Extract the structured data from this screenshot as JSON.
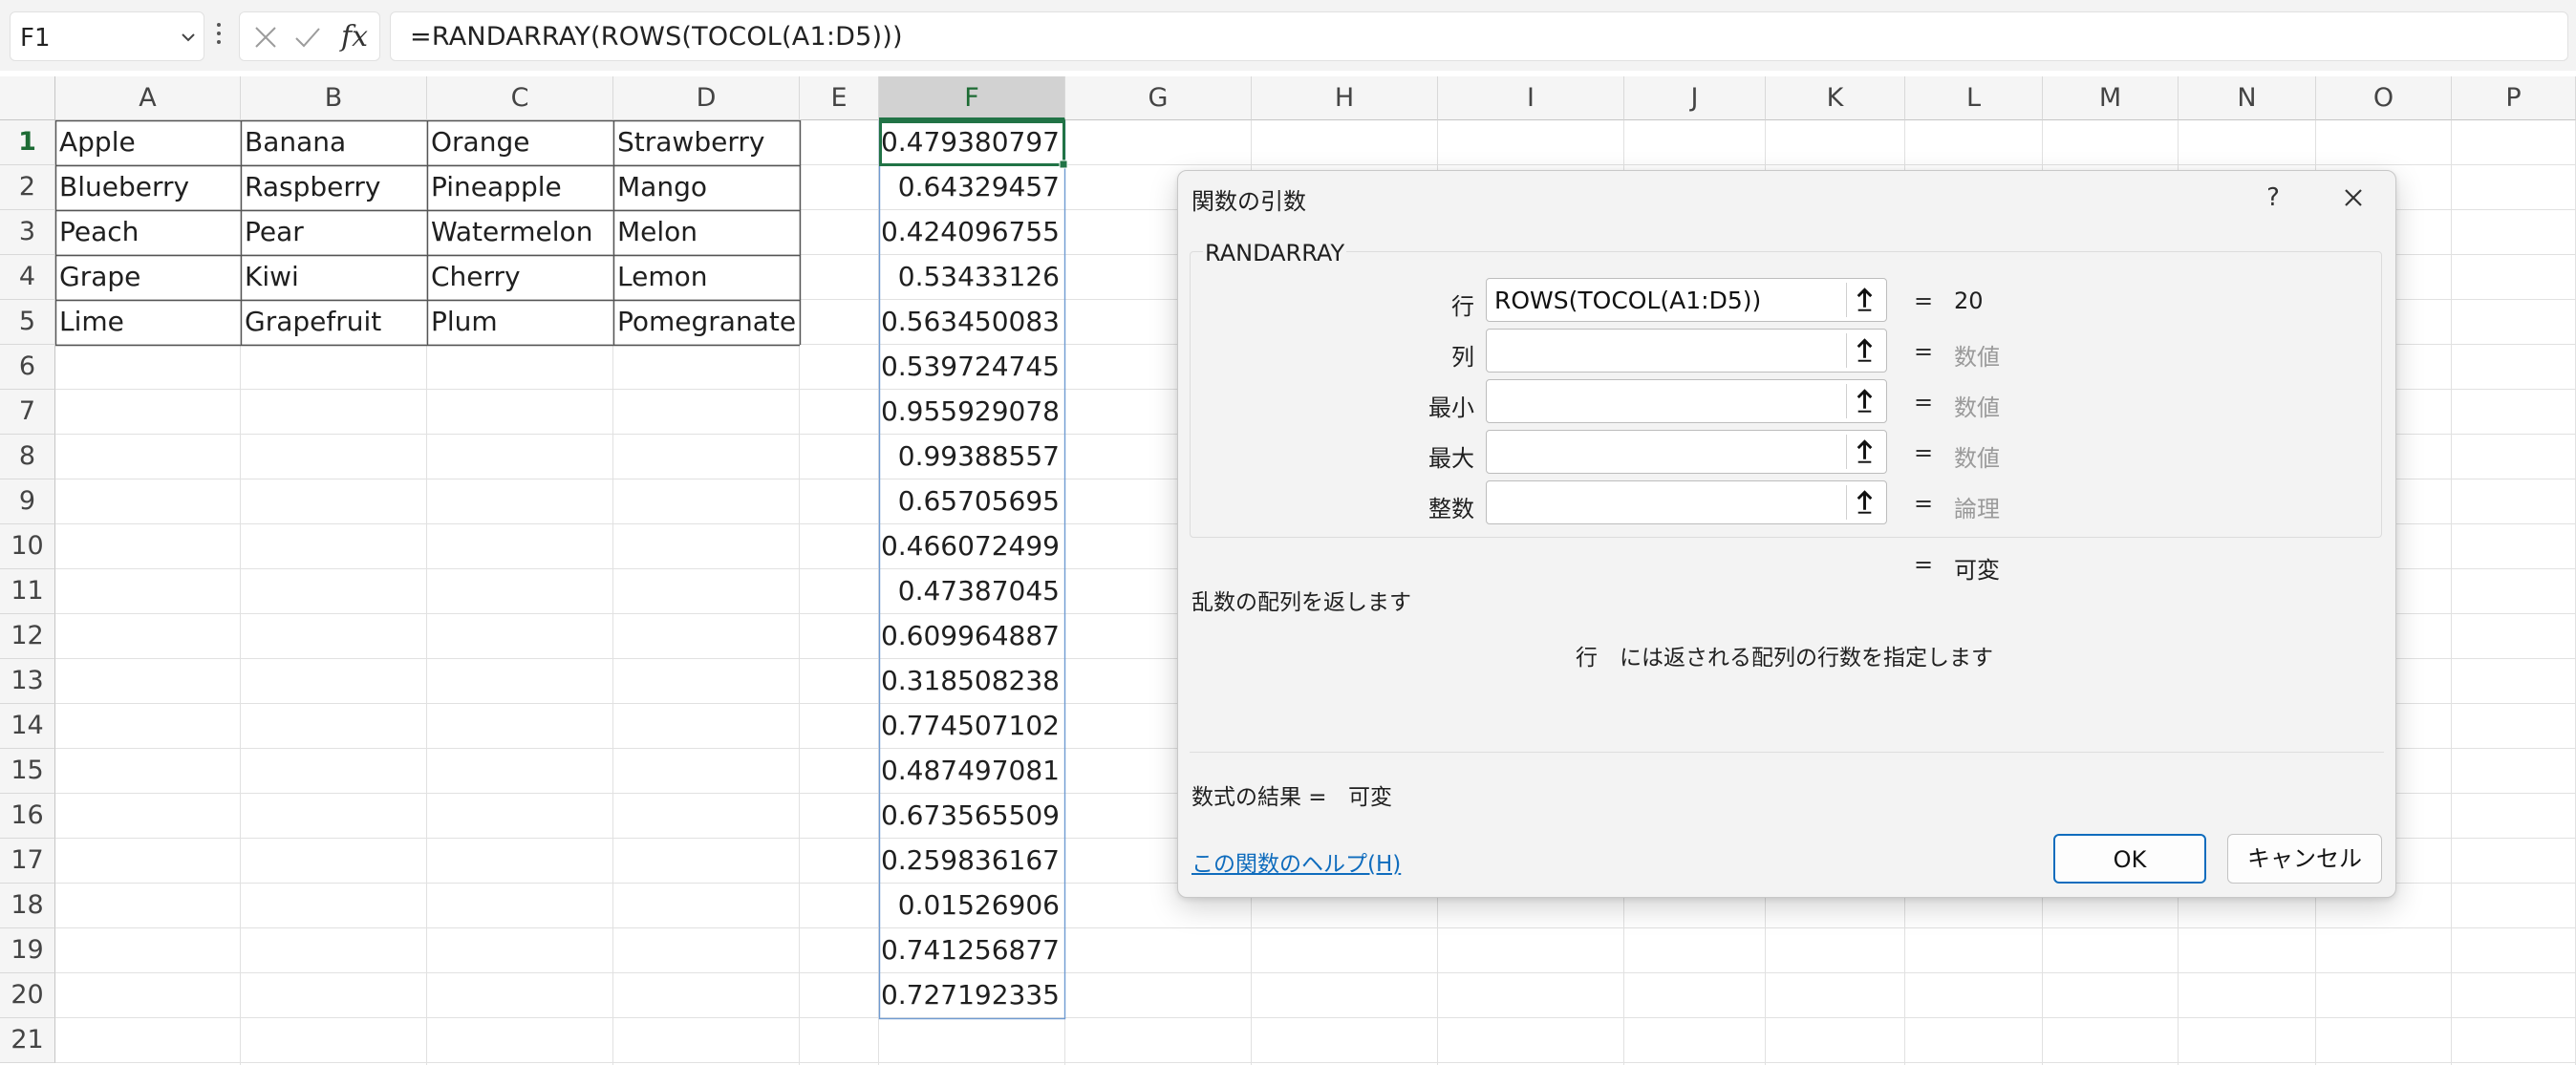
{
  "formula_bar": {
    "name_box": "F1",
    "formula": "=RANDARRAY(ROWS(TOCOL(A1:D5)))"
  },
  "columns": [
    "A",
    "B",
    "C",
    "D",
    "E",
    "F",
    "G",
    "H",
    "I",
    "J",
    "K",
    "L",
    "M",
    "N",
    "O",
    "P"
  ],
  "rows": [
    "1",
    "2",
    "3",
    "4",
    "5",
    "6",
    "7",
    "8",
    "9",
    "10",
    "11",
    "12",
    "13",
    "14",
    "15",
    "16",
    "17",
    "18",
    "19",
    "20",
    "21"
  ],
  "selected_column": "F",
  "selected_row": "1",
  "table": [
    [
      "Apple",
      "Banana",
      "Orange",
      "Strawberry"
    ],
    [
      "Blueberry",
      "Raspberry",
      "Pineapple",
      "Mango"
    ],
    [
      "Peach",
      "Pear",
      "Watermelon",
      "Melon"
    ],
    [
      "Grape",
      "Kiwi",
      "Cherry",
      "Lemon"
    ],
    [
      "Lime",
      "Grapefruit",
      "Plum",
      "Pomegranate"
    ]
  ],
  "random_values": [
    "0.479380797",
    "0.64329457",
    "0.424096755",
    "0.53433126",
    "0.563450083",
    "0.539724745",
    "0.955929078",
    "0.99388557",
    "0.65705695",
    "0.466072499",
    "0.47387045",
    "0.609964887",
    "0.318508238",
    "0.774507102",
    "0.487497081",
    "0.673565509",
    "0.259836167",
    "0.01526906",
    "0.741256877",
    "0.727192335"
  ],
  "dialog": {
    "title": "関数の引数",
    "help_symbol": "?",
    "function_name": "RANDARRAY",
    "args": [
      {
        "label": "行",
        "value": "ROWS(TOCOL(A1:D5))",
        "result": "20",
        "hint": false
      },
      {
        "label": "列",
        "value": "",
        "result": "数値",
        "hint": true
      },
      {
        "label": "最小",
        "value": "",
        "result": "数値",
        "hint": true
      },
      {
        "label": "最大",
        "value": "",
        "result": "数値",
        "hint": true
      },
      {
        "label": "整数",
        "value": "",
        "result": "論理",
        "hint": true
      }
    ],
    "equals": "=",
    "overall_result": "可変",
    "description": "乱数の配列を返します",
    "arg_help_name": "行",
    "arg_help_text": "には返される配列の行数を指定します",
    "formula_result_label": "数式の結果 =",
    "formula_result_value": "可変",
    "help_link": "この関数のヘルプ(H)",
    "ok_label": "OK",
    "cancel_label": "キャンセル"
  },
  "colors": {
    "accent_green": "#217346",
    "link_blue": "#0f6cbd"
  }
}
